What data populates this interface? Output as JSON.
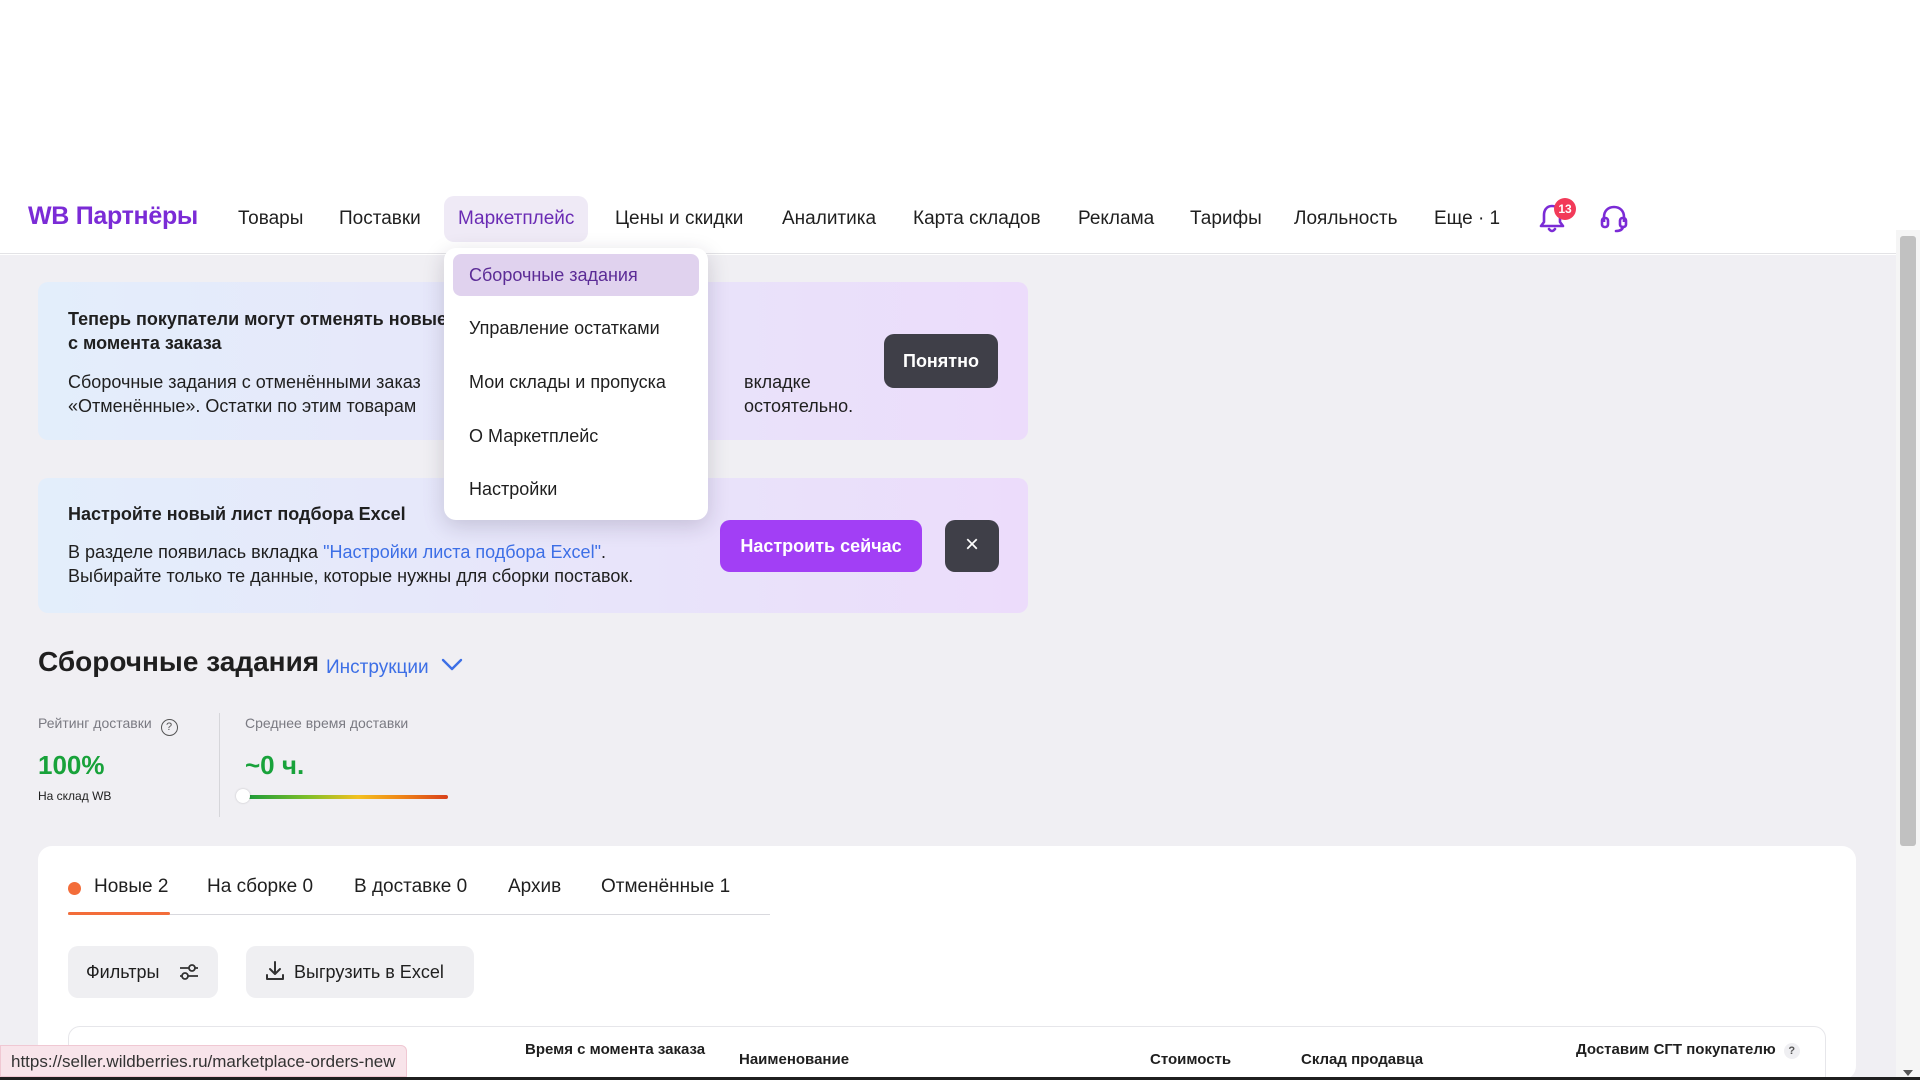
{
  "header": {
    "logo": "WB Партнёры",
    "nav": [
      "Товары",
      "Поставки",
      "Маркетплейс",
      "Цены и скидки",
      "Аналитика",
      "Карта складов",
      "Реклама",
      "Тарифы",
      "Лояльность",
      "Еще · 1"
    ],
    "active_nav": "Маркетплейс",
    "notifications_count": "13"
  },
  "dropdown": {
    "items": [
      "Сборочные задания",
      "Управление остатками",
      "Мои склады и пропуска",
      "О Маркетплейс",
      "Настройки"
    ],
    "active_item": "Сборочные задания"
  },
  "banner1": {
    "title_line1": "Теперь покупатели могут отменять новые",
    "title_line2": "с момента заказа",
    "text_line1_left": "Сборочные задания с отменёнными заказ",
    "text_line1_right": "вкладке",
    "text_line2_left": "«Отменённые». Остатки по этим товарам",
    "text_line2_right": "остоятельно.",
    "button": "Понятно"
  },
  "banner2": {
    "title": "Настройте новый лист подбора Excel",
    "text_prefix": "В разделе появилась вкладка ",
    "text_link": "\"Настройки листа подбора Excel\"",
    "text_suffix": ".",
    "text_line2": "Выбирайте только те данные, которые нужны для сборки поставок.",
    "button": "Настроить сейчас",
    "close": "×"
  },
  "section": {
    "title": "Сборочные задания",
    "instructions": "Инструкции"
  },
  "stats": {
    "rating_label": "Рейтинг доставки",
    "rating_value": "100%",
    "rating_sub": "На склад WB",
    "avg_label": "Среднее время доставки",
    "avg_value": "~0 ч."
  },
  "tabs": [
    "Новые 2",
    "На сборке 0",
    "В доставке 0",
    "Архив",
    "Отменённые 1"
  ],
  "active_tab": "Новые 2",
  "actions": {
    "filters": "Фильтры",
    "export": "Выгрузить в Excel"
  },
  "table": {
    "headers": [
      "Время с момента заказа",
      "Наименование",
      "Стоимость",
      "Склад продавца",
      "Доставим СГТ покупателю"
    ]
  },
  "status_url": "https://seller.wildberries.ru/marketplace-orders-new",
  "colors": {
    "brand": "#7b2bd6",
    "accent_purple": "#a23ff5",
    "success": "#18a23a",
    "tab_accent": "#f36d3a",
    "badge": "#f23a59"
  }
}
